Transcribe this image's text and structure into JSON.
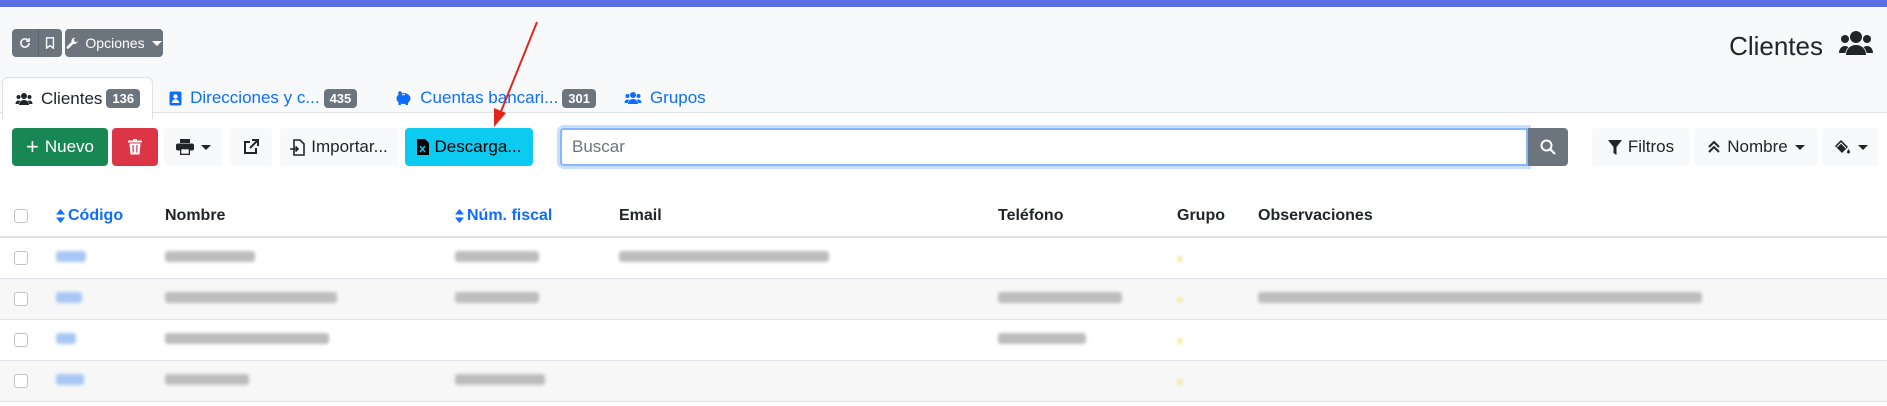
{
  "header": {
    "title": "Clientes",
    "options_label": "Opciones"
  },
  "tabs": [
    {
      "label": "Clientes",
      "count": "136",
      "icon": "users-icon"
    },
    {
      "label": "Direcciones y c...",
      "count": "435",
      "icon": "address-book-icon"
    },
    {
      "label": "Cuentas bancari...",
      "count": "301",
      "icon": "piggy-bank-icon"
    },
    {
      "label": "Grupos",
      "count": "",
      "icon": "users-cog-icon"
    }
  ],
  "toolbar": {
    "new_label": "Nuevo",
    "import_label": "Importar...",
    "download_label": "Descarga...",
    "search_placeholder": "Buscar",
    "filters_label": "Filtros",
    "sort_label": "Nombre"
  },
  "table": {
    "columns": [
      "Código",
      "Nombre",
      "Núm. fiscal",
      "Email",
      "Teléfono",
      "Grupo",
      "Observaciones"
    ],
    "rows": [
      {
        "blur": [
          1,
          1,
          1,
          1,
          0,
          1,
          0
        ]
      },
      {
        "blur": [
          1,
          1,
          1,
          0,
          1,
          1,
          1
        ]
      },
      {
        "blur": [
          1,
          1,
          0,
          0,
          1,
          1,
          0
        ]
      },
      {
        "blur": [
          1,
          1,
          1,
          0,
          0,
          1,
          0
        ]
      }
    ]
  },
  "colors": {
    "accent": "#5b6ee1",
    "primary": "#0d6efd",
    "success": "#198754",
    "danger": "#dc3545",
    "info": "#0dcaf0",
    "secondary": "#6c757d",
    "annotation": "#e3261c"
  }
}
